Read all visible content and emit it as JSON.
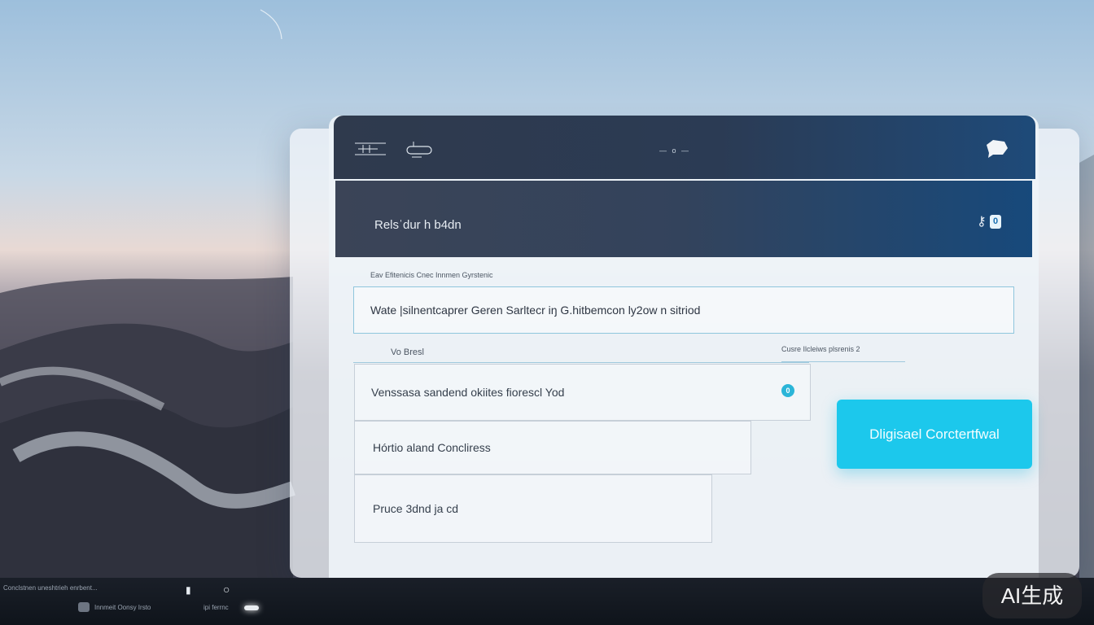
{
  "titlebar": {
    "title": "— o —"
  },
  "header": {
    "title": "Relsˈdur h b4dn",
    "badge": "0"
  },
  "form": {
    "section_label": "Eav Efitenicis Cnec   Innmen Gyrstenic",
    "search_value": "Wate |silnentcaprer Geren Sarltecr    iŋ G.hitbemcon ly2ow n sitriod",
    "field_label": "Vo Bresl",
    "right_label": "Cusre Ilcleiws plsrenis 2",
    "shield_glyph": "0",
    "item1": "Venssasa sandend okiites fiorescl Yod",
    "item2": "Hórtio aland Concliress",
    "item3": "Pruce 3dnd ja cd",
    "cta_label": "Dligisael Corctertfwal"
  },
  "taskbar": {
    "status_text": "Conclstnen uneshtrieh enrbent...",
    "app_label": "Innmeit Oonsy Irsto",
    "app_label2": "ipi ferrnc"
  },
  "watermark": "AI生成",
  "colors": {
    "accent": "#1cc8ec",
    "header_dark": "#2f3a4d",
    "header_blue": "#1e4a79"
  }
}
